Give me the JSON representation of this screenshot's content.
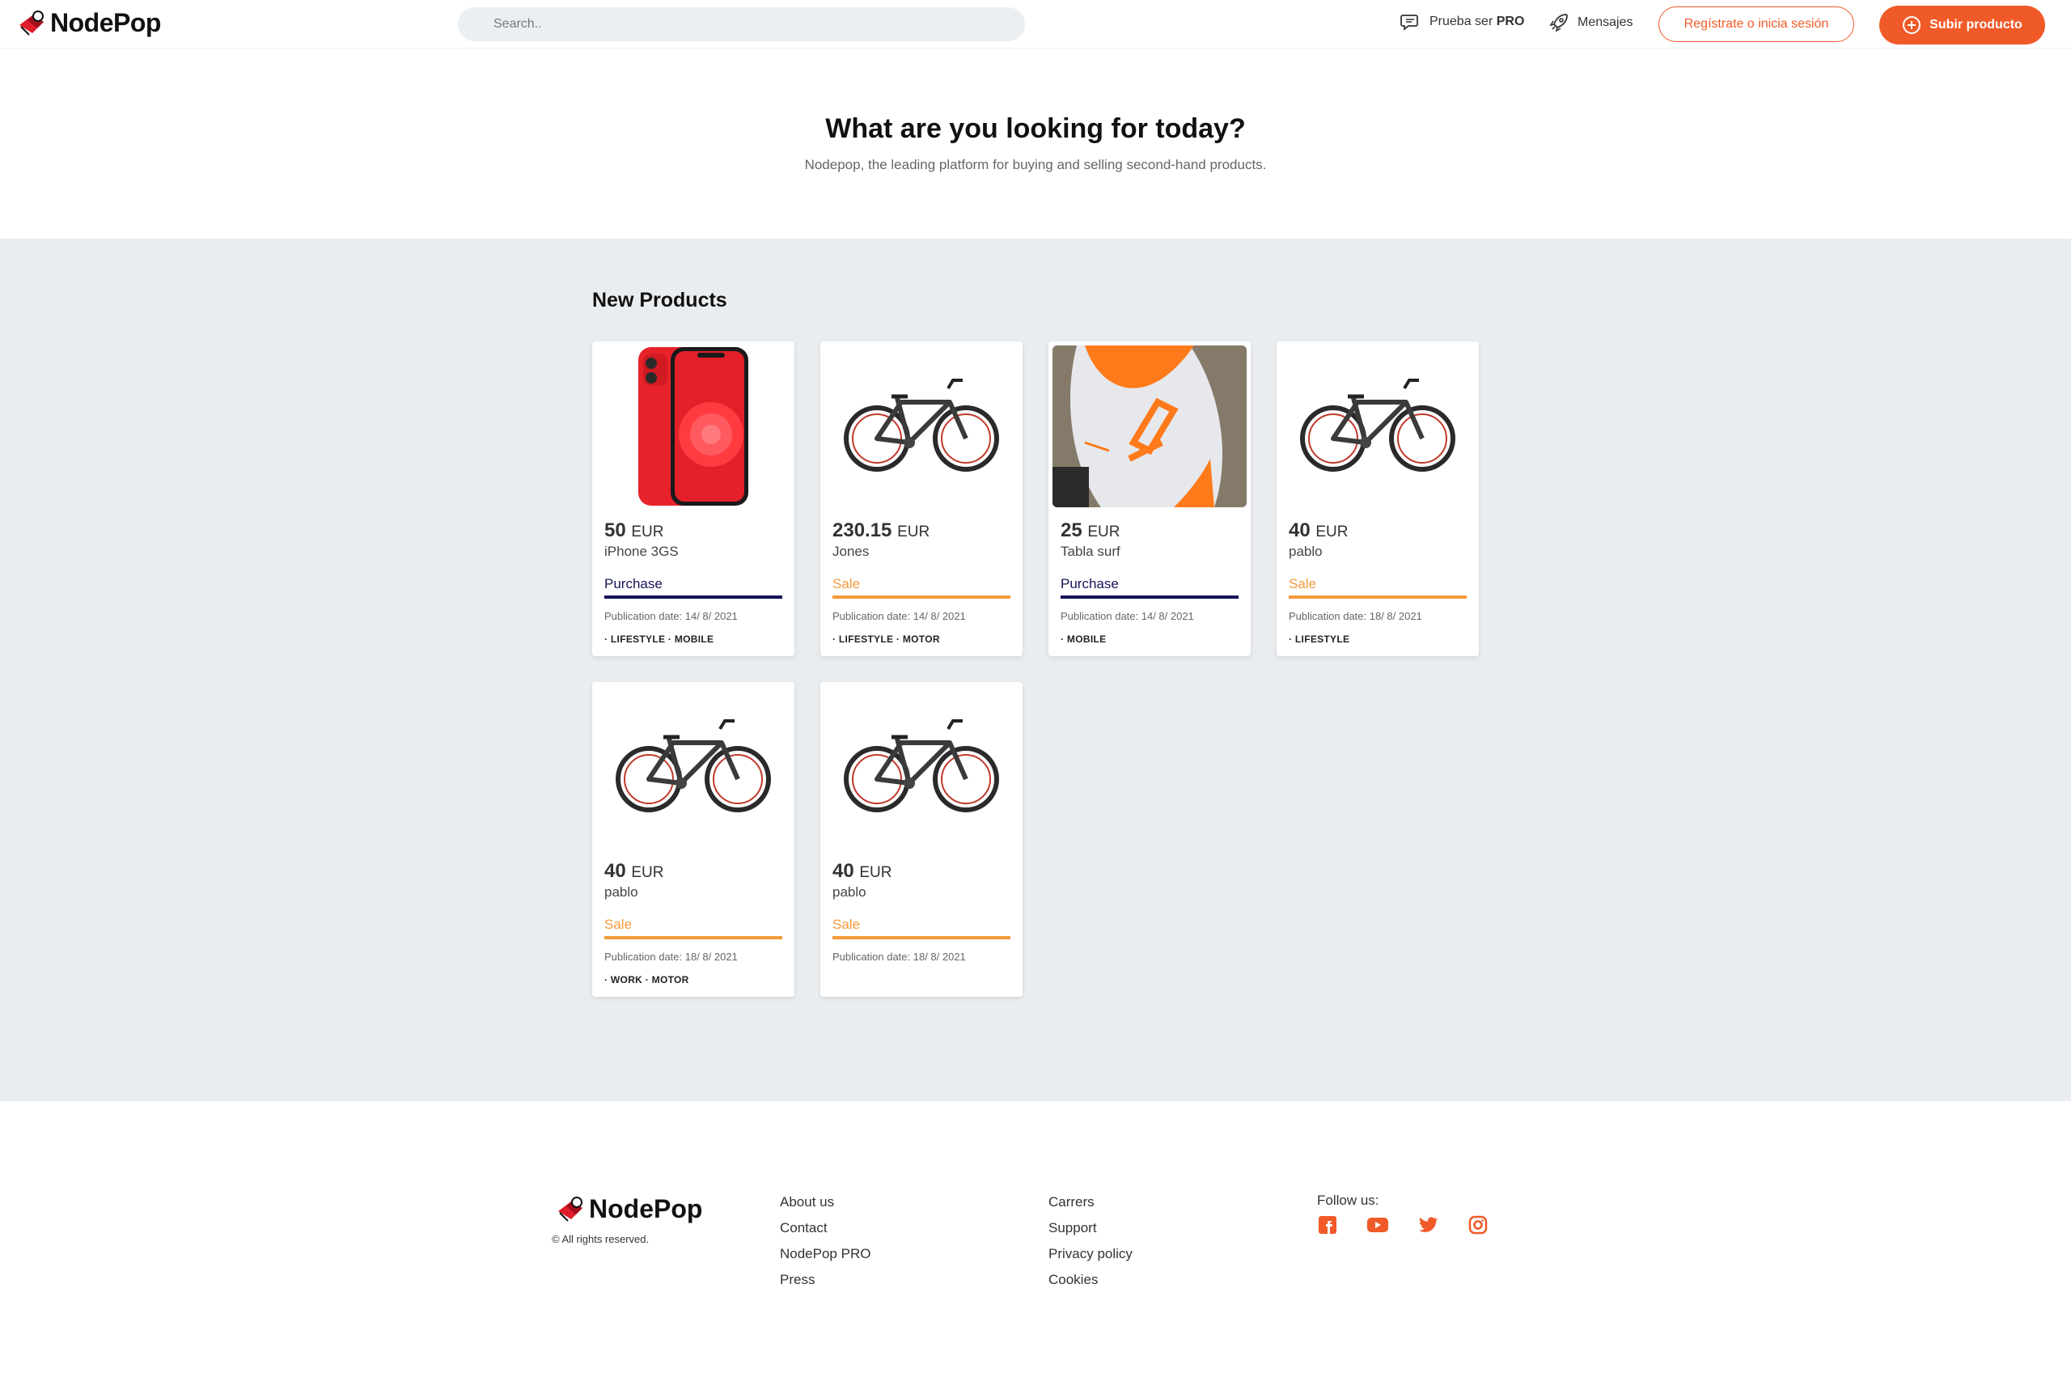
{
  "header": {
    "logo_text": "NodePop",
    "search_placeholder": "Search..",
    "pro_label": "Prueba ser",
    "pro_badge": "PRO",
    "messages_label": "Mensajes",
    "login_label": "Regístrate o inicia sesión",
    "upload_label": "Subir producto",
    "accent_color": "#f05a28"
  },
  "hero": {
    "title": "What are you looking for today?",
    "subtitle": "Nodepop, the leading platform for buying and selling second-hand products."
  },
  "main": {
    "section_title": "New Products",
    "products": [
      {
        "price": "50",
        "currency": "EUR",
        "name": "iPhone 3GS",
        "type": "Purchase",
        "date": "Publication date: 14/ 8/ 2021",
        "tags": "· LIFESTYLE · MOBILE",
        "image": "phone"
      },
      {
        "price": "230.15",
        "currency": "EUR",
        "name": "Jones",
        "type": "Sale",
        "date": "Publication date: 14/ 8/ 2021",
        "tags": "· LIFESTYLE · MOTOR",
        "image": "bike"
      },
      {
        "price": "25",
        "currency": "EUR",
        "name": "Tabla surf",
        "type": "Purchase",
        "date": "Publication date: 14/ 8/ 2021",
        "tags": "· MOBILE",
        "image": "surfboard"
      },
      {
        "price": "40",
        "currency": "EUR",
        "name": "pablo",
        "type": "Sale",
        "date": "Publication date: 18/ 8/ 2021",
        "tags": "· LIFESTYLE",
        "image": "bike"
      },
      {
        "price": "40",
        "currency": "EUR",
        "name": "pablo",
        "type": "Sale",
        "date": "Publication date: 18/ 8/ 2021",
        "tags": "· WORK · MOTOR",
        "image": "bike"
      },
      {
        "price": "40",
        "currency": "EUR",
        "name": "pablo",
        "type": "Sale",
        "date": "Publication date: 18/ 8/ 2021",
        "tags": "",
        "image": "bike"
      }
    ]
  },
  "footer": {
    "logo_text": "NodePop",
    "copyright": "© All rights reserved.",
    "col1": [
      "About us",
      "Contact",
      "NodePop PRO",
      "Press"
    ],
    "col2": [
      "Carrers",
      "Support",
      "Privacy policy",
      "Cookies"
    ],
    "follow_label": "Follow us:",
    "social_icons": [
      "facebook-icon",
      "youtube-icon",
      "twitter-icon",
      "instagram-icon"
    ]
  }
}
